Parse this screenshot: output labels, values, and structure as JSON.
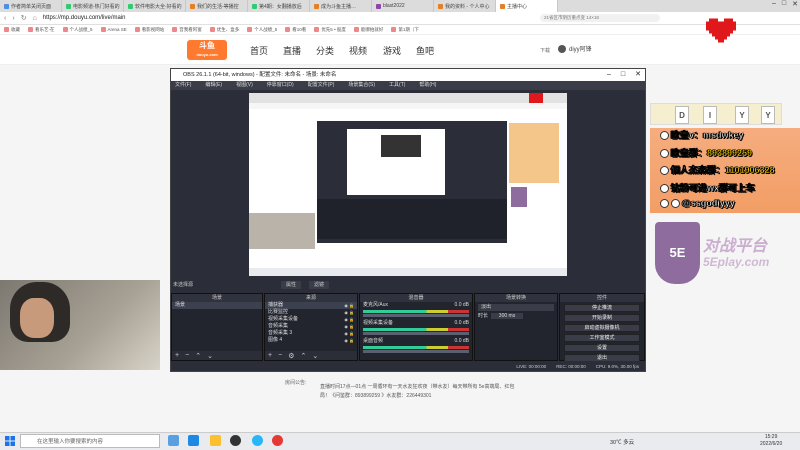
{
  "browser": {
    "tabs": [
      {
        "label": "作者简单关闭页面",
        "color": "#4a90e2"
      },
      {
        "label": "电影频道-热门好看的",
        "color": "#2ecc71"
      },
      {
        "label": "软件电影大全-好看的",
        "color": "#2ecc71"
      },
      {
        "label": "我们的生活-等播控",
        "color": "#e67e22"
      },
      {
        "label": "第4期：女翻播放后",
        "color": "#2ecc71"
      },
      {
        "label": "成为斗鱼主播…",
        "color": "#e67e22"
      },
      {
        "label": "blast2022",
        "color": "#8e44ad"
      },
      {
        "label": "我的资料 - 个人中心",
        "color": "#e67e22"
      },
      {
        "label": "主播中心",
        "color": "#e67e22"
      }
    ],
    "url": "https://mp.douyu.com/live/main",
    "search_placeholder": "21省区市阴历重点变 14×18",
    "bookmarks": [
      "收藏",
      "看乐艺·在",
      "个人战绩_5",
      "Arena SE",
      "看影视网站",
      "音我看阿富",
      "优生、盒多",
      "个人战绩_5",
      "看10看",
      "优先5 • 股度",
      "能哪拍就好",
      "第1期（下"
    ]
  },
  "douyu": {
    "logo": "斗鱼",
    "logo_sub": "douyu.com",
    "nav": [
      "首页",
      "直播",
      "分类",
      "视频",
      "游戏",
      "鱼吧"
    ],
    "download": "下载",
    "username": "diyy阿锋"
  },
  "obs": {
    "title": "OBS 26.1.1 (64-bit, windows) - 配置文件: 未命名 - 场景: 未命名",
    "menu": [
      "文件(F)",
      "编辑(E)",
      "视图(V)",
      "停靠窗口(D)",
      "配置文件(P)",
      "场景集合(S)",
      "工具(T)",
      "帮助(H)"
    ],
    "preview_label": "未选择源",
    "prop_btn": "属性",
    "filter_btn": "滤镜",
    "scenes_header": "场景",
    "scenes": [
      "场景"
    ],
    "sources_header": "来源",
    "sources": [
      "捕获器",
      "比赛监控",
      "视频采集设备",
      "音频采集",
      "音频采集 3",
      "图像 4"
    ],
    "mixer_header": "混音器",
    "mixer": [
      {
        "name": "麦克风/Aux",
        "db": "0.0 dB"
      },
      {
        "name": "视频采集设备",
        "db": "0.0 dB"
      },
      {
        "name": "桌面音频",
        "db": "0.0 dB"
      }
    ],
    "transitions_header": "场景转换",
    "transition": "淡出",
    "duration_label": "时长",
    "duration": "300 ms",
    "controls_header": "控件",
    "controls": [
      "停止推流",
      "开始录制",
      "启动虚拟摄像机",
      "工作室模式",
      "设置",
      "退出"
    ],
    "status": {
      "live": "LIVE: 00:00:00",
      "rec": "REC: 00:00:00",
      "cpu": "CPU: 9.0%, 30.00 fps"
    }
  },
  "overlay": {
    "diy": [
      "D",
      "I",
      "Y",
      "Y"
    ],
    "lines": [
      {
        "label": "欧皇v：",
        "value": "msdwkey"
      },
      {
        "label": "欧皇群：",
        "value": "893899259"
      },
      {
        "label": "個人杰森群：",
        "value": "1101906328"
      },
      {
        "label": "钻粉可进wx群可上车",
        "value": ""
      },
      {
        "label": "",
        "value": "@ssgodiyyy"
      }
    ],
    "logo": "5E",
    "brand1": "对战平台",
    "brand2": "5Eplay.com"
  },
  "page": {
    "notice_label": "房间公告:",
    "notice_text": "直播时间17点—01点 一周循环有一天水友狂欢夜（带水友）每天带所有 5e高端局、红包局！《问鉴群：893899259 》水友群：226449301"
  },
  "taskbar": {
    "search": "在这里输入你要搜索的内容",
    "weather": "30℃ 多云",
    "time": "15:29",
    "date": "2022/6/20"
  },
  "colors": {
    "douyu_orange": "#ff7a2f",
    "obs_bg": "#2b2e38",
    "overlay_yellow": "#ffd800"
  }
}
